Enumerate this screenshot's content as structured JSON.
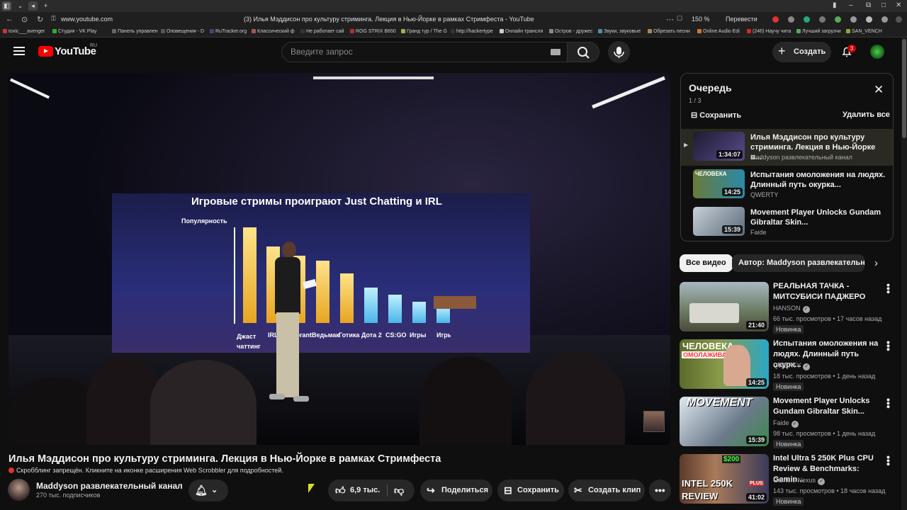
{
  "browser": {
    "url": "www.youtube.com",
    "tab_title": "(3) Илья Мэддисон про культуру стриминга. Лекция в Нью-Йорке в рамках Стримфеста - YouTube",
    "zoom": "150 %",
    "translate_label": "Перевести",
    "bookmarks": [
      "toxic___avenger",
      "Студия - VK Play",
      "Панель управлен",
      "Оповещения - D",
      "RuTracker.org",
      "Классический ф",
      "Не работает сай",
      "ROG STRIX B650",
      "Гранд тур / The G",
      "http://hackertype",
      "Онлайн трансля",
      "Остров - дружес",
      "Звуки, звуковые",
      "Обрезать песни",
      "Online Audio Edi",
      "(246) Научу чита",
      "Лучший загрузчи",
      "SAN_VENCH"
    ]
  },
  "header": {
    "logo_text": "YouTube",
    "region": "RU",
    "search_placeholder": "Введите запрос",
    "create_label": "Создать",
    "notifications_count": "3"
  },
  "video": {
    "slide_title": "Игровые стримы проиграют Just Chatting и IRL",
    "slide_ylabel": "Популярность",
    "slide_categories": [
      "Джаст чаттинг",
      "IRL",
      "Valorant",
      "Ведьмак",
      "Готика",
      "Дота 2",
      "CS:GO",
      "Игры",
      "Игры"
    ],
    "title": "Илья Мэддисон про культуру стриминга. Лекция в Нью-Йорке в рамках Стримфеста",
    "scrobbler_note": "Скробблинг запрещён. Кликните на иконке расширения Web Scrobbler для подробностей.",
    "channel_name": "Maddyson развлекательный канал",
    "subscribers": "270 тыс. подписчиков",
    "likes": "6,9 тыс.",
    "share_label": "Поделиться",
    "save_label": "Сохранить",
    "clip_label": "Создать клип"
  },
  "queue": {
    "title": "Очередь",
    "position": "1 / 3",
    "save_label": "Сохранить",
    "delete_all_label": "Удалить все",
    "items": [
      {
        "title": "Илья Мэддисон про культуру стриминга. Лекция в Нью-Йорке в...",
        "channel": "Maddyson развлекательный канал",
        "duration": "1:34:07"
      },
      {
        "title": "Испытания омоложения на людях. Длинный путь окурка...",
        "channel": "QWERTY",
        "duration": "14:25"
      },
      {
        "title": "Movement Player Unlocks Gundam Gibraltar Skin...",
        "channel": "Faide",
        "duration": "15:39"
      }
    ]
  },
  "chips": {
    "all": "Все видео",
    "author": "Автор: Maddyson развлекательный канал"
  },
  "recommendations": [
    {
      "title": "РЕАЛЬНАЯ ТАЧКА - МИТСУБИСИ ПАДЖЕРО",
      "channel": "HANSON",
      "meta": "66 тыс. просмотров • 17 часов назад",
      "badge": "Новинка",
      "duration": "21:40"
    },
    {
      "title": "Испытания омоложения на людях. Длинный путь окурк...",
      "channel": "QWERTY",
      "meta": "18 тыс. просмотров • 1 день назад",
      "badge": "Новинка",
      "duration": "14:25"
    },
    {
      "title": "Movement Player Unlocks Gundam Gibraltar Skin...",
      "channel": "Faide",
      "meta": "98 тыс. просмотров • 1 день назад",
      "badge": "Новинка",
      "duration": "15:39"
    },
    {
      "title": "Intel Ultra 5 250K Plus CPU Review & Benchmarks: Gamin...",
      "channel": "Gamers Nexus",
      "meta": "143 тыс. просмотров • 18 часов назад",
      "badge": "Новинка",
      "duration": "41:02"
    }
  ],
  "thumb_text": {
    "q2": "ЧЕЛОВЕКА",
    "r2": "ОМОЛАЖИВАЮТ?!",
    "r3": "MOVEMENT",
    "r4a": "INTEL 250K",
    "r4b": "REVIEW",
    "r4c": "$200",
    "r4d": "PLUS"
  },
  "colors": {
    "accent": "#ff0000",
    "bg": "#0f0f0f",
    "chip": "#272727"
  }
}
